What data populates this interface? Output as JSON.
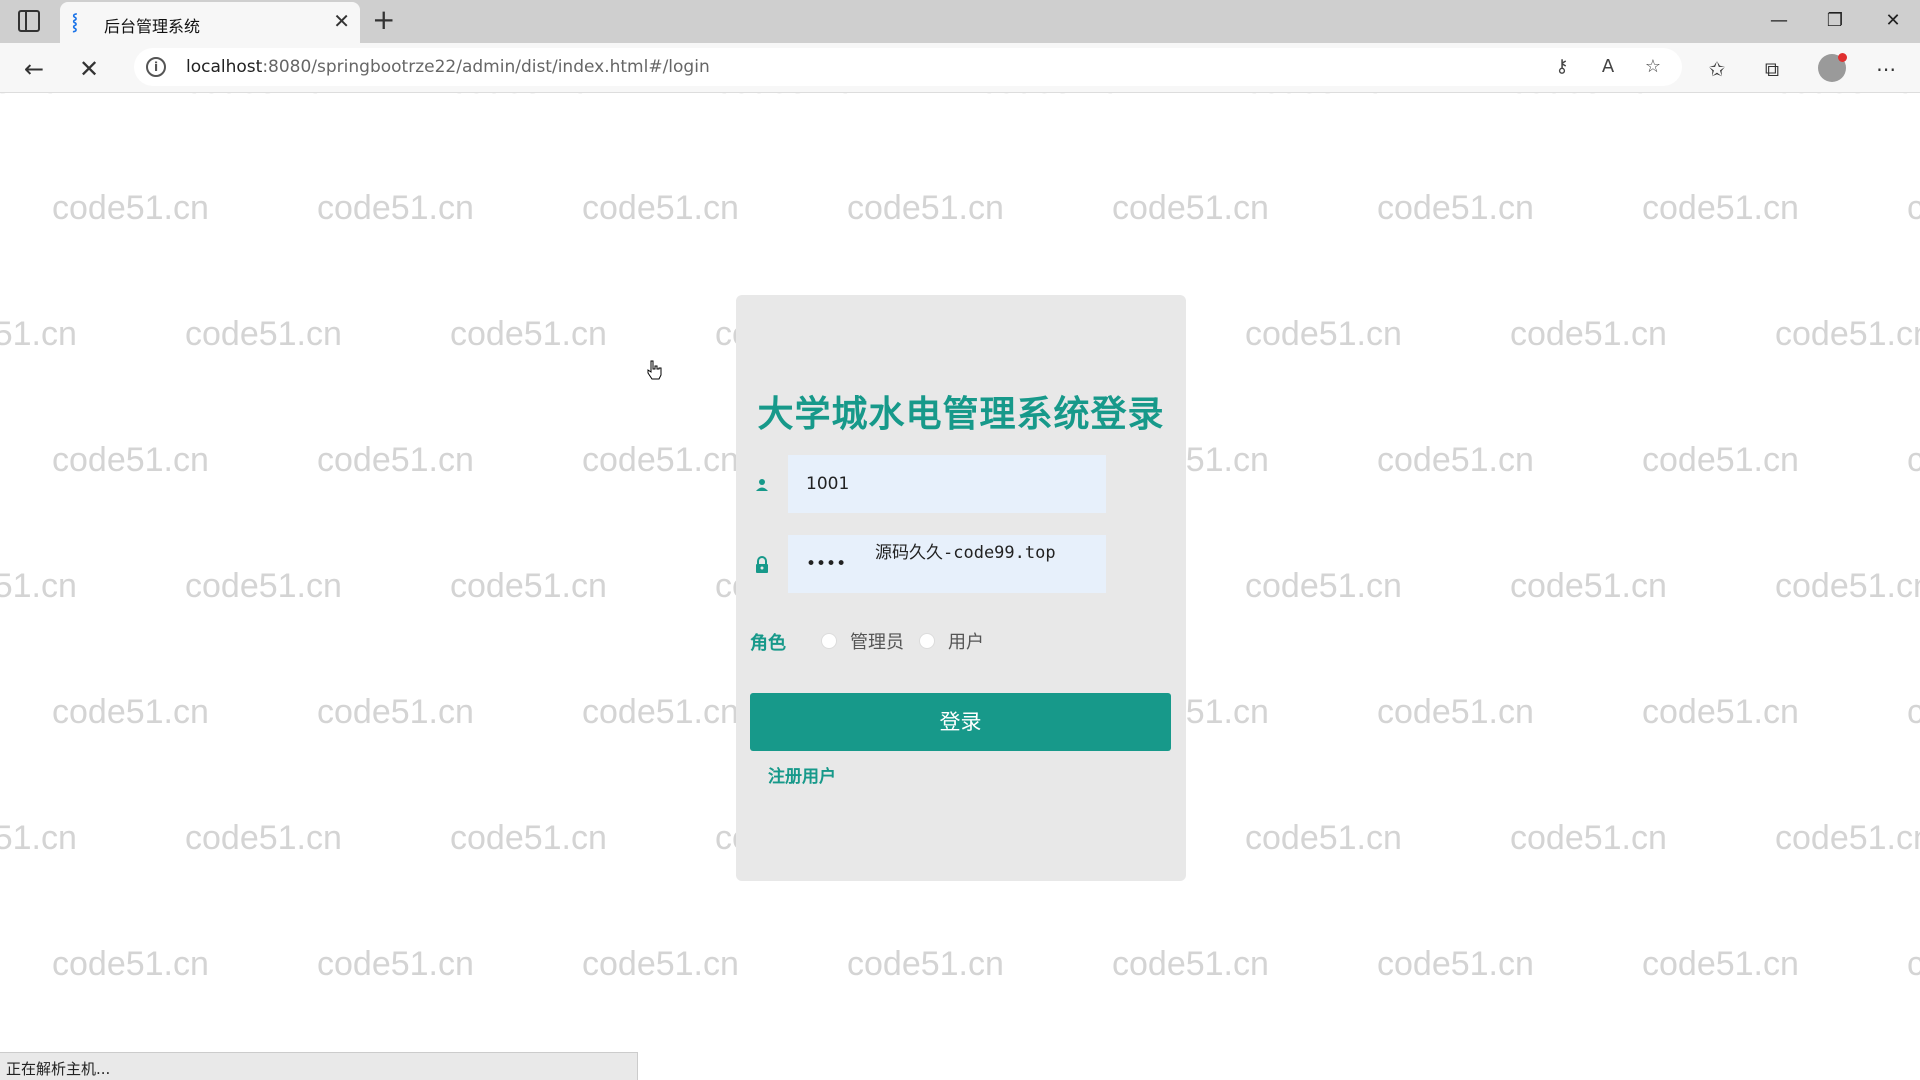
{
  "browser": {
    "tab_title": "后台管理系统",
    "url_host": "localhost",
    "url_rest": ":8080/springbootrze22/admin/dist/index.html#/login",
    "status_text": "正在解析主机..."
  },
  "watermark": {
    "text": "code51.cn"
  },
  "login": {
    "title": "大学城水电管理系统登录",
    "username_value": "1001",
    "password_value": "••••",
    "password_overlay_text": "源码久久-code99.top",
    "role_label": "角色",
    "role_options": [
      "管理员",
      "用户"
    ],
    "login_button": "登录",
    "register_link": "注册用户"
  },
  "colors": {
    "accent": "#17998a",
    "card_bg": "#e8e8e8",
    "input_bg": "#e7f0fb"
  }
}
